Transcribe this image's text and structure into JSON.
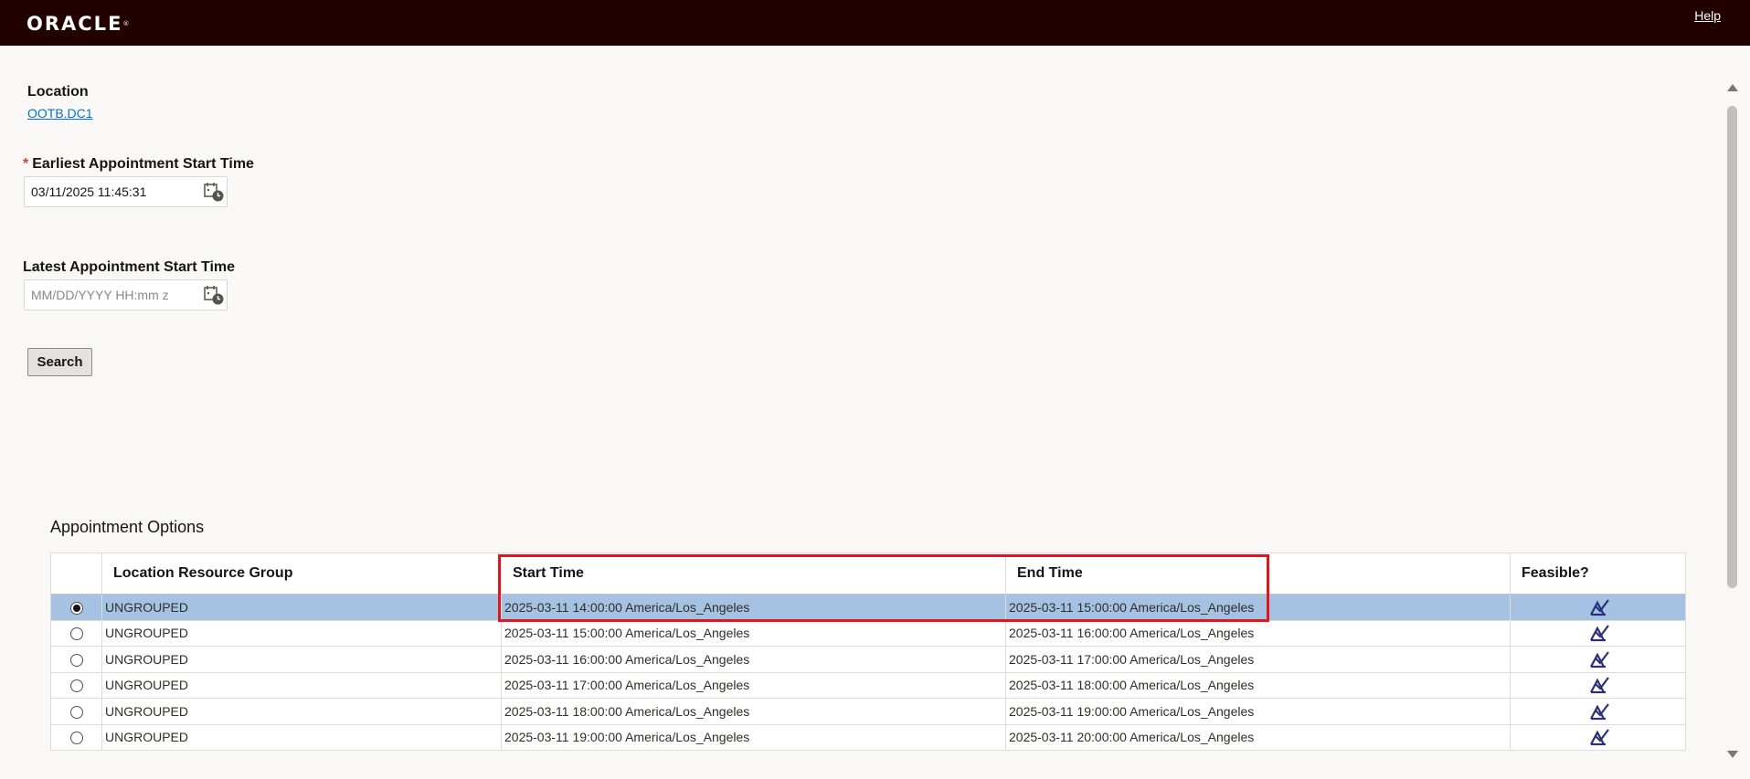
{
  "header": {
    "logo_text": "ORACLE",
    "logo_mark": "®",
    "help_label": "Help"
  },
  "form": {
    "location_label": "Location",
    "location_value": "OOTB.DC1",
    "earliest_required_mark": "*",
    "earliest_label": "Earliest Appointment Start Time",
    "earliest_value": "03/11/2025 11:45:31",
    "latest_label": "Latest Appointment Start Time",
    "latest_placeholder": "MM/DD/YYYY HH:mm z",
    "calendar_icon": "calendar-clock-icon",
    "search_label": "Search"
  },
  "options": {
    "title": "Appointment Options",
    "columns": [
      "Location Resource Group",
      "Start Time",
      "End Time",
      "Feasible?"
    ],
    "feasible_icon": "feasible-check-icon",
    "rows": [
      {
        "group": "UNGROUPED",
        "start": "2025-03-11 14:00:00 America/Los_Angeles",
        "end": "2025-03-11 15:00:00 America/Los_Angeles",
        "selected": true
      },
      {
        "group": "UNGROUPED",
        "start": "2025-03-11 15:00:00 America/Los_Angeles",
        "end": "2025-03-11 16:00:00 America/Los_Angeles",
        "selected": false
      },
      {
        "group": "UNGROUPED",
        "start": "2025-03-11 16:00:00 America/Los_Angeles",
        "end": "2025-03-11 17:00:00 America/Los_Angeles",
        "selected": false
      },
      {
        "group": "UNGROUPED",
        "start": "2025-03-11 17:00:00 America/Los_Angeles",
        "end": "2025-03-11 18:00:00 America/Los_Angeles",
        "selected": false
      },
      {
        "group": "UNGROUPED",
        "start": "2025-03-11 18:00:00 America/Los_Angeles",
        "end": "2025-03-11 19:00:00 America/Los_Angeles",
        "selected": false
      },
      {
        "group": "UNGROUPED",
        "start": "2025-03-11 19:00:00 America/Los_Angeles",
        "end": "2025-03-11 20:00:00 America/Los_Angeles",
        "selected": false
      }
    ]
  },
  "colors": {
    "header_bg": "#230000",
    "selected_row": "#a5c2e2",
    "highlight_box": "#e0161e",
    "link": "#0572ce"
  }
}
